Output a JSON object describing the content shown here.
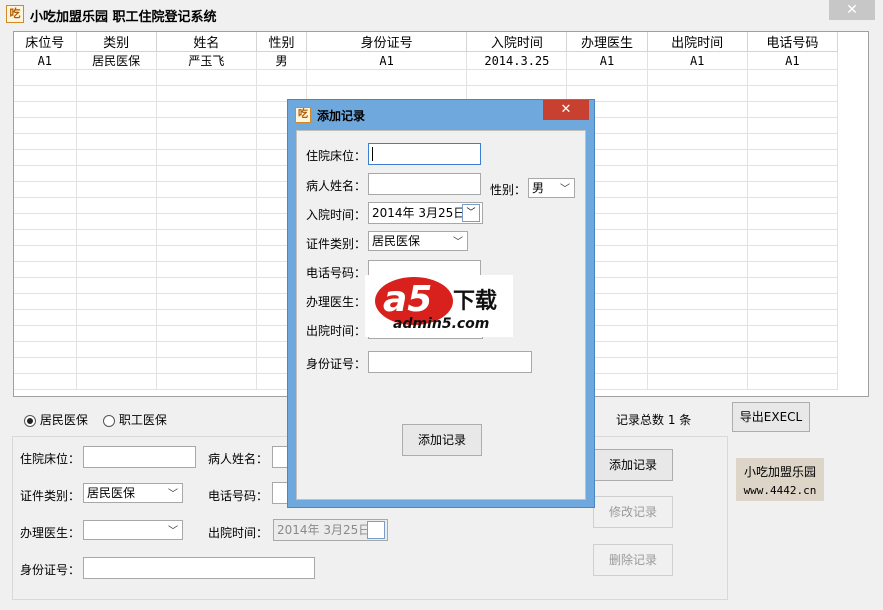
{
  "window": {
    "icon_glyph": "吃",
    "title": "小吃加盟乐园 职工住院登记系统",
    "close_glyph": "✕"
  },
  "table": {
    "columns": [
      "床位号",
      "类别",
      "姓名",
      "性别",
      "身份证号",
      "入院时间",
      "办理医生",
      "出院时间",
      "电话号码"
    ],
    "rows": [
      [
        "A1",
        "居民医保",
        "严玉飞",
        "男",
        "A1",
        "2014.3.25",
        "A1",
        "A1",
        "A1"
      ]
    ]
  },
  "filter": {
    "radio1": "居民医保",
    "radio2": "职工医保",
    "selected": "radio1",
    "record_count": "记录总数 1 条",
    "export_label": "导出EXECL"
  },
  "form": {
    "bed_label": "住院床位：",
    "name_label": "病人姓名：",
    "cert_label": "证件类别：",
    "cert_value": "居民医保",
    "phone_label": "电话号码：",
    "doctor_label": "办理医生：",
    "doctor_value": "",
    "discharge_label": "出院时间：",
    "discharge_value": "2014年 3月25日",
    "id_label": "身份证号：",
    "add_label": "添加记录",
    "edit_label": "修改记录",
    "delete_label": "删除记录"
  },
  "brand": {
    "line1": "小吃加盟乐园",
    "line2": "www.4442.cn"
  },
  "dialog": {
    "icon_glyph": "吃",
    "title": "添加记录",
    "close_glyph": "✕",
    "bed_label": "住院床位：",
    "name_label": "病人姓名：",
    "gender_label": "性别：",
    "gender_value": "男",
    "admit_label": "入院时间：",
    "admit_value": "2014年 3月25日",
    "cert_label": "证件类别：",
    "cert_value": "居民医保",
    "phone_label": "电话号码：",
    "doctor_label": "办理医生：",
    "discharge_label": "出院时间：",
    "id_label": "身份证号：",
    "submit_label": "添加记录"
  },
  "watermark": {
    "big": "a5",
    "small": "下载",
    "site": "admin5.com"
  }
}
